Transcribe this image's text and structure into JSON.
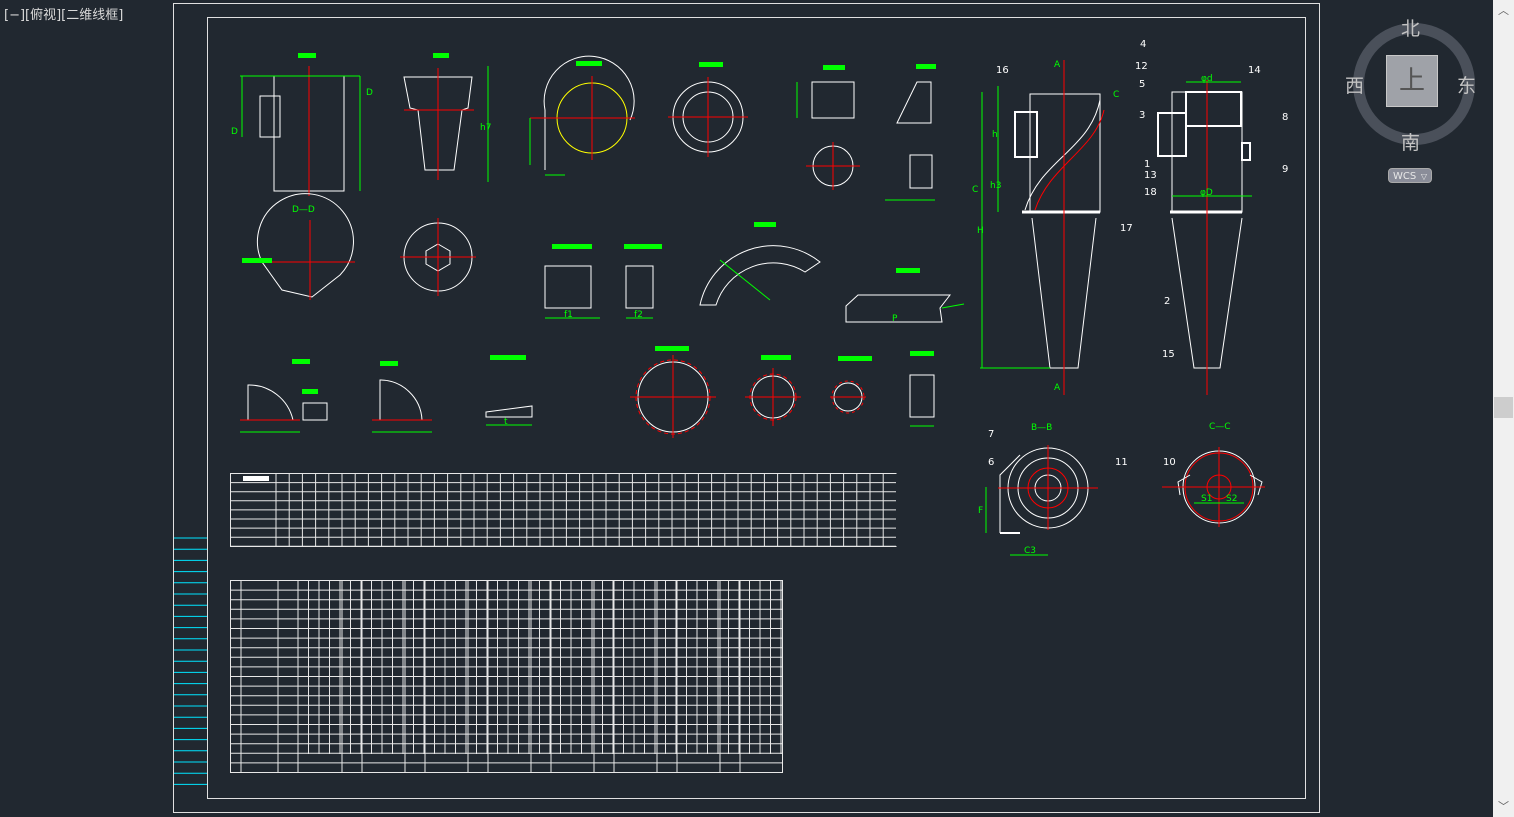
{
  "viewport": {
    "label": "[−][俯视][二维线框]"
  },
  "viewcube": {
    "north": "北",
    "south": "南",
    "east": "东",
    "west": "西",
    "face": "上",
    "coord_system": "WCS",
    "coord_dropdown_icon": "triangle-down"
  },
  "scrollbar": {
    "up_icon": "chevron-up",
    "down_icon": "chevron-down"
  },
  "colors": {
    "background": "#212830",
    "outline": "#ffffff",
    "dimension": "#00ff00",
    "centerline": "#ff0000",
    "highlight": "#ffff00",
    "frame_strip": "#00e5ff"
  },
  "drawing": {
    "part_numbers": [
      "16",
      "4",
      "12",
      "5",
      "3",
      "14",
      "8",
      "9",
      "1",
      "13",
      "18",
      "17",
      "2",
      "15",
      "7",
      "6",
      "11",
      "10"
    ],
    "section_labels": {
      "a_top": "A",
      "a_bottom": "A",
      "c_left": "C",
      "c_right": "C",
      "bb": "B—B",
      "cc": "C—C",
      "dd": "D—D",
      "d_left": "D",
      "d_right": "D"
    },
    "dimensions": {
      "H": "H",
      "h": "h",
      "h3": "h3",
      "dD": "φD",
      "dd": "φd",
      "C3": "C3",
      "F": "F",
      "S1": "S1",
      "S2": "S2",
      "f1": "f1",
      "f2": "f2",
      "t": "t",
      "P": "P",
      "h7": "h7"
    }
  }
}
